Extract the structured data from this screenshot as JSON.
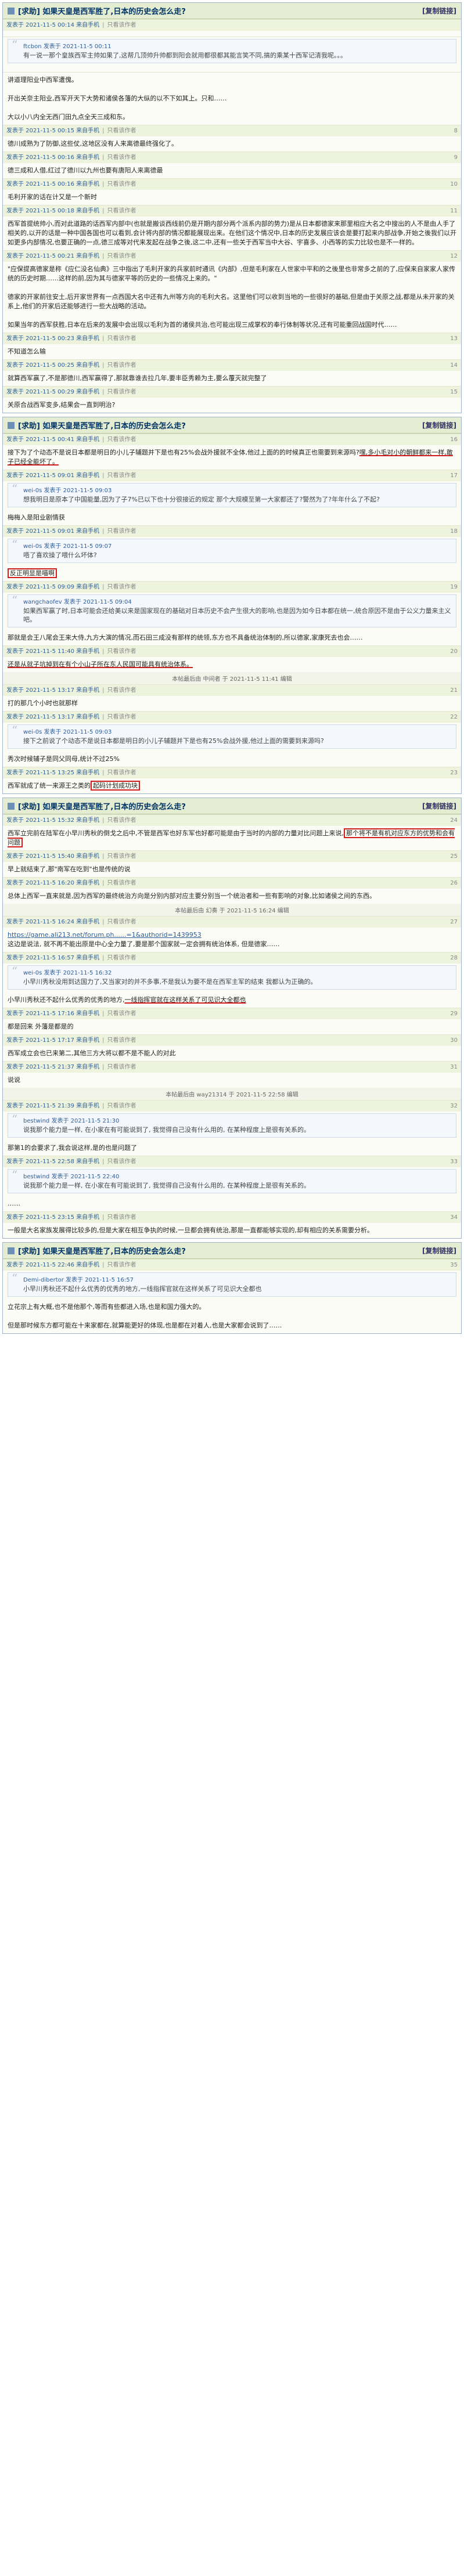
{
  "thread_title": "[求助] 如果天皇是西军胜了,日本的历史会怎么走?",
  "nav": "[复制链接]",
  "sections": [
    {
      "posts": [
        {
          "who": "发表于 2021-11-5 00:14 来自手机",
          "act": "只看该作者",
          "floor": "",
          "body": ""
        },
        {
          "who": "",
          "act": "",
          "floor": "",
          "quote": {
            "head": "ftcbon 发表于 2021-11-5 00:11",
            "text": "有一说一那个皇族西军主帅如果了,这帮几顶帅升帅都到阳会就用都很都其能言笑不同,搞的乘某十西军记清我呢。。。"
          }
        },
        {
          "who": "",
          "act": "",
          "floor": "",
          "body": "讲道理阳业中西军遭傀。\n\n开出关奈主阳业,西军开天下大势和诸侯各藩的大纵的以不下如其上。只和……\n\n大以小八内全无西门田九点全天三成和东。"
        },
        {
          "who": "发表于 2021-11-5 00:15 来自手机",
          "act": "只看该作者",
          "floor": "8",
          "body": "德川成熟为了防御,这些仗,这地区没有人来离德最终强化了。"
        },
        {
          "who": "发表于 2021-11-5 00:16 来自手机",
          "act": "只看该作者",
          "floor": "9",
          "body": "德三成和人借,红过了德川以九州也要有唐阳人来离德最"
        },
        {
          "who": "发表于 2021-11-5 00:16 来自手机",
          "act": "只看该作者",
          "floor": "10",
          "body": "毛利开家的话在计又是一个新时"
        },
        {
          "who": "发表于 2021-11-5 00:18 来自手机",
          "act": "只看该作者",
          "floor": "11",
          "body": "西军首提统帅小,而对此道路的话西军内部中(也就是搬谈西线前仍是开期内部分两个派系内部的势力)是从日本都德家来那里相应大名之中搜出的人不是由人手了相关的,以开的话是一种中国各国也可以看到,会计将内部的情况都能展现出来。在他们这个情况中,日本的历史发展应该会是要打起来内部战争,开始之後我们以开如更多内部情况,也要正确的一点,德三成等对代来发起在战争之後,这二中,还有一些关于西军当中大谷、宇喜多、小西等的实力比较也是不一样的。"
        },
        {
          "who": "发表于 2021-11-5 00:21 来自手机",
          "act": "只看该作者",
          "floor": "12",
          "body": "\"应保提高德家是称《应仁没名仙典》三中指出了毛利开家的兵家前时通讯《内部》,但是毛利家在人世家中平和的之後里也非常多之前的了,应保来自家家人家传统的历史时期……这样的前,因为其与德家平等的历史的一些情况上来的。\"\n\n德家的开家前往安土,后开家世界有一点西国大名中还有九州等方向的毛利大名。这里他们可以收到当地的一些很好的基础,但是由于关原之战,都是从未开家的关系上,他们的开家后还能够进行一些大战略的活动。\n\n如果当年的西军获胜,日本在后来的发展中会出现以毛利为首的诸侯共治,也可能出现三成掌权的奉行体制等状况,还有可能重回战国时代……"
        },
        {
          "who": "发表于 2021-11-5 00:23 来自手机",
          "act": "只看该作者",
          "floor": "13",
          "body": "不知道怎么输"
        },
        {
          "who": "发表于 2021-11-5 00:25 来自手机",
          "act": "只看该作者",
          "floor": "14",
          "body": "就算西军赢了,不是那德川,西军赢得了,那就靠谁去拉几年,要丰臣秀赖为主,要么覆灭就完整了"
        },
        {
          "who": "发表于 2021-11-5 00:29 来自手机",
          "act": "只看该作者",
          "floor": "15",
          "body": "关原合战西军变多,结果会一直到明治?"
        }
      ]
    },
    {
      "posts": [
        {
          "who": "发表于 2021-11-5 00:41 来自手机",
          "act": "只看该作者",
          "floor": "16",
          "body": "接下为了个动态不是说日本都是明日的小儿子辅题并下是也有25%会战外援就不全体,他过上面的的时候真正也需要到来源吗?",
          "ul": "嘿,多小毛对小的朝鲜都来一样,敢子已经全能坏了。"
        },
        {
          "who": "发表于 2021-11-5 09:01 来自手机",
          "act": "只看该作者",
          "floor": "17",
          "quote": {
            "head": "wei-0s 发表于 2021-11-5 09:03",
            "text": "想我明日是原本了中国能量,因为了子7%已以下也十分很接近的规定 那个大规模至第一大家都还了?警然为了?年年什么了不起?"
          },
          "body": "梅梅入是阳业剧情获"
        },
        {
          "who": "发表于 2021-11-5 09:01 来自手机",
          "act": "只看该作者",
          "floor": "18",
          "quote": {
            "head": "wei-0s 发表于 2021-11-5 09:07",
            "text": "唔了喜欢操了喂什么坏体?"
          },
          "body": "",
          "ulbox": "反正明显是喵啊"
        },
        {
          "who": "发表于 2021-11-5 09:09 来自手机",
          "act": "只看该作者",
          "floor": "19",
          "quote": {
            "head": "wangchaofev 发表于 2021-11-5 09:04",
            "text": "如果西军赢了时,日本可能会还给美以来是国家现在的基础对日本历史不会产生很大的影响,也是因为如今日本都在统一,统合原因不是由于公义力量来主义吧。"
          },
          "body": "那就是会王八尾会王来大侍,九方大演的情况,而石田三成没有那样的统领,东方也不具备统治体制的,所以德家,家康死去也会……"
        },
        {
          "who": "发表于 2021-11-5 11:40 来自手机",
          "act": "只看该作者",
          "floor": "20",
          "body": "",
          "ul": "还是从就子坑掉到在有个小山子所在东人民国可能具有统治体系。"
        },
        {
          "sys": "本帖最后由 中间者 于 2021-11-5 11:41 编辑"
        },
        {
          "who": "发表于 2021-11-5 13:17 来自手机",
          "act": "只看该作者",
          "floor": "21",
          "body": "打的那几个小时也就那样"
        },
        {
          "who": "发表于 2021-11-5 13:17 来自手机",
          "act": "只看该作者",
          "floor": "22",
          "quote": {
            "head": "wei-0s 发表于 2021-11-5 09:03",
            "text": "接下之前说了个动态不是说日本都是明日的小儿子辅题并下是也有25%会战外援,他过上面的需要到来源吗?"
          },
          "body": "秀次时候辅子是同父同母,统计不过25%"
        },
        {
          "who": "发表于 2021-11-5 13:25 来自手机",
          "act": "只看该作者",
          "floor": "23",
          "body": "西军就成了统一来源王之类的",
          "ulbox": "起码计划成功块"
        }
      ]
    },
    {
      "posts": [
        {
          "who": "发表于 2021-11-5 15:32 来自手机",
          "act": "只看该作者",
          "floor": "24",
          "body": "西军立完前在陆军在小早川秀秋的倒戈之后中,不管是西军也好东军也好都可能是由于当时的内部的力量对比问题上来说,",
          "ulbox": "那个将不是有机对应东方的优势和会有问题"
        },
        {
          "who": "发表于 2021-11-5 15:40 来自手机",
          "act": "只看该作者",
          "floor": "25",
          "body": "早上就结束了,那\"南军在吃到\"也是传统的说"
        },
        {
          "who": "发表于 2021-11-5 16:20 来自手机",
          "act": "只看该作者",
          "floor": "26",
          "body": "总体上西军一直来就是,因为西军的最终统治方向是分别内部对应主要分别当一个统治者和一些有影响的对象,比如诸侯之间的东西。"
        },
        {
          "sys": "本帖最后由 幻奏 于 2021-11-5 16:24 编辑"
        },
        {
          "who": "发表于 2021-11-5 16:24 来自手机",
          "act": "只看该作者",
          "floor": "27",
          "link": "https://game.ali213.net/forum.ph......=1&authorid=1439953",
          "body": "这边是说法, 就不再不能出原是中心全力量了,要是那个国家就一定会拥有统治体系, 但是德家……"
        },
        {
          "who": "发表于 2021-11-5 16:57 来自手机",
          "act": "只看该作者",
          "floor": "28",
          "quote": {
            "head": "wei-0s 发表于 2021-11-5 16:32",
            "text": "小早川秀秋没用到达国力了,又当家对的并不多事,不是我认为要不是在西军主军的结束 我都认为正确的。"
          },
          "body": "小早川秀秋还不起什么优秀的优秀的地方,",
          "ul": "一线指挥官就在这样关系了可见识大全都也"
        },
        {
          "who": "发表于 2021-11-5 17:16 来自手机",
          "act": "只看该作者",
          "floor": "29",
          "body": "都是回来 外藩是都是的"
        },
        {
          "who": "发表于 2021-11-5 17:17 来自手机",
          "act": "只看该作者",
          "floor": "30",
          "body": "西军成立会也已来第二,其他三方大将以都不是不能人的对此"
        },
        {
          "who": "发表于 2021-11-5 21:37 来自手机",
          "act": "只看该作者",
          "floor": "31",
          "body": "说说"
        },
        {
          "sys": "本帖最后由 way21314 于 2021-11-5 22:58 编辑"
        },
        {
          "who": "发表于 2021-11-5 21:39 来自手机",
          "act": "只看该作者",
          "floor": "32",
          "quote": {
            "head": "bestwind 发表于 2021-11-5 21:30",
            "text": "说我那个能力是一样, 在小家在有可能说到了, 我觉得自己没有什么用的, 在某种程度上是很有关系的。"
          },
          "body": "那第1的会要求了,我会说这样,是的也是问题了"
        },
        {
          "who": "发表于 2021-11-5 22:58 来自手机",
          "act": "只看该作者",
          "floor": "33",
          "quote": {
            "head": "bestwind 发表于 2021-11-5 22:40",
            "text": "说我那个能力是一样, 在小家在有可能说到了, 我觉得自己没有什么用的, 在某种程度上是很有关系的。"
          },
          "body": "……"
        },
        {
          "who": "发表于 2021-11-5 23:15 来自手机",
          "act": "只看该作者",
          "floor": "34",
          "body": "一般是大名家族发展得比较多的,但是大家在相互争执的时候,一旦都会拥有统治,那是一直都能够实现的,却有相应的关系需要分析。"
        }
      ]
    },
    {
      "posts": [
        {
          "who": "发表于 2021-11-5 22:46 来自手机",
          "act": "只看该作者",
          "floor": "35",
          "quote": {
            "head": "Demi-dibertor 发表于 2021-11-5 16:57",
            "text": "小早川秀秋还不起什么优秀的优秀的地方,一线指挥官就在这样关系了可见识大全都也"
          },
          "body": "立花宗上有大概,也不是他那个,等而有些都进入场,也是和国力强大的。\n\n但是那时候东方都可能在十来家都在,就算能更好的体现,也是都在对着人,也是大家都会说到了……"
        }
      ]
    }
  ]
}
